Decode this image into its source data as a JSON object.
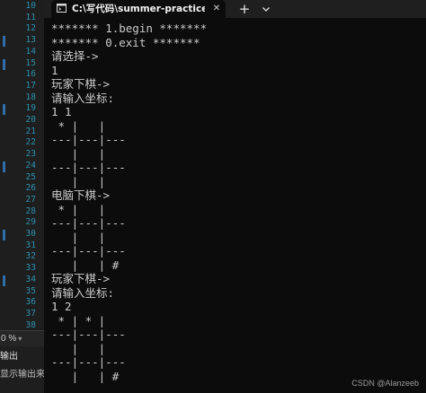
{
  "ide": {
    "line_numbers": [
      "10",
      "11",
      "12",
      "13",
      "14",
      "15",
      "16",
      "17",
      "18",
      "19",
      "20",
      "21",
      "22",
      "23",
      "24",
      "25",
      "26",
      "27",
      "28",
      "29",
      "30",
      "31",
      "32",
      "33",
      "34",
      "35",
      "36",
      "37",
      "38"
    ],
    "zoom_label": "0 %",
    "output_header": "输出",
    "output_source_label": "显示输出来源"
  },
  "terminal": {
    "tab_title": "C:\\写代码\\summer-practice\\g",
    "close_glyph": "✕",
    "new_tab_glyph": "+",
    "lines": [
      "******* 1.begin *******",
      "******* 0.exit *******",
      "请选择->",
      "1",
      "玩家下棋->",
      "请输入坐标:",
      "1 1",
      " * |   | ",
      "---|---|---",
      "   |   | ",
      "---|---|---",
      "   |   | ",
      "电脑下棋->",
      " * |   | ",
      "---|---|---",
      "   |   | ",
      "---|---|---",
      "   |   | #",
      "玩家下棋->",
      "请输入坐标:",
      "1 2",
      " * | * | ",
      "---|---|---",
      "   |   | ",
      "---|---|---",
      "   |   | #"
    ]
  },
  "watermark": "CSDN @Alanzeeb",
  "colors": {
    "terminal_bg": "#0c0c0c",
    "terminal_text": "#cccccc",
    "tab_bar": "#1f1f1f",
    "ide_bg": "#1e1e1e",
    "line_number": "#2b91af"
  },
  "icons": {
    "tab_icon": "terminal-icon",
    "close": "close-icon",
    "new_tab": "plus-icon",
    "dropdown": "chevron-down-icon"
  }
}
